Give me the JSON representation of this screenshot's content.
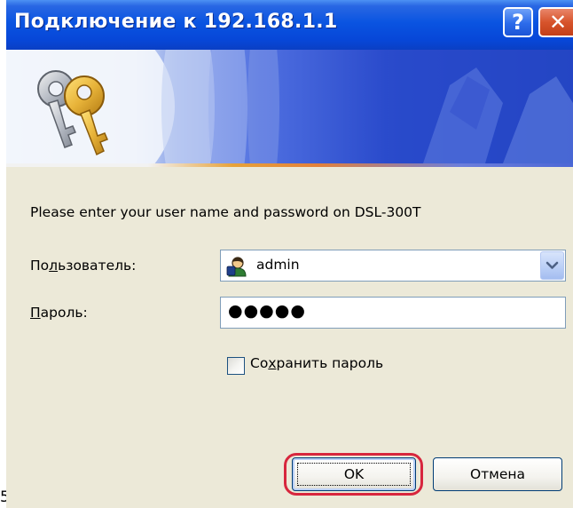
{
  "window": {
    "title": "Подключение к 192.168.1.1",
    "help_glyph": "?",
    "close_glyph": "✕"
  },
  "banner": {
    "icon": "keys-icon"
  },
  "prompt": "Please enter your user name and password on DSL-300T",
  "username": {
    "label_pre": "По",
    "label_accel": "л",
    "label_post": "ьзователь:",
    "value": "admin",
    "icon": "user-icon"
  },
  "password": {
    "label_accel": "П",
    "label_post": "ароль:",
    "value_masked": "●●●●●"
  },
  "remember": {
    "label_pre": "Со",
    "label_accel": "х",
    "label_post": "ранить пароль",
    "checked": false
  },
  "buttons": {
    "ok": "OK",
    "cancel": "Отмена"
  },
  "stray_mark": "5",
  "colors": {
    "titlebar": "#0A54E1",
    "dialog_bg": "#ECE9D8",
    "highlight": "#D7263D"
  }
}
